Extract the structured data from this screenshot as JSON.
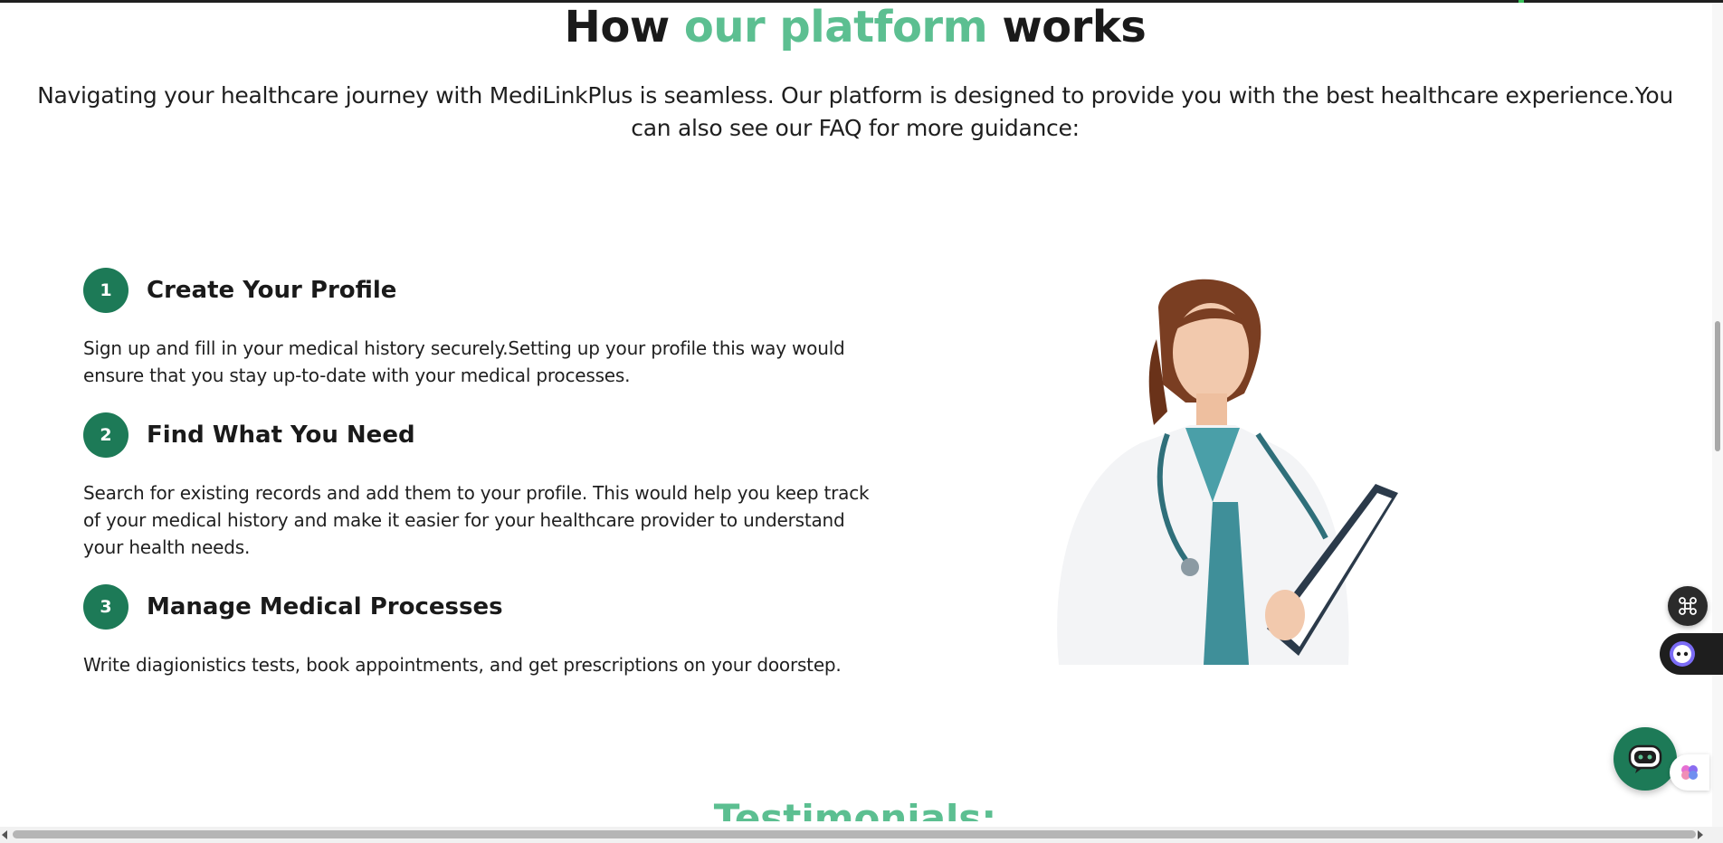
{
  "section": {
    "heading_part1": "How ",
    "heading_accent": "our platform",
    "heading_part2": " works",
    "intro": "Navigating your healthcare journey with MediLinkPlus is seamless. Our platform is designed to provide you with the best healthcare experience.You can also see our FAQ for more guidance:"
  },
  "steps": [
    {
      "number": "1",
      "title": "Create Your Profile",
      "description": "Sign up and fill in your medical history securely.Setting up your profile this way would ensure that you stay up-to-date with your medical processes."
    },
    {
      "number": "2",
      "title": "Find What You Need",
      "description": "Search for existing records and add them to your profile. This would help you keep track of your medical history and make it easier for your healthcare provider to understand your health needs."
    },
    {
      "number": "3",
      "title": "Manage Medical Processes",
      "description": "Write diagionistics tests, book appointments, and get prescriptions on your doorstep."
    }
  ],
  "testimonials": {
    "title": "Testimonials:"
  },
  "icons": {
    "shortcut": "command-icon",
    "assistant": "robot-icon",
    "chat": "chatbot-icon",
    "brain": "brain-icon",
    "illustration": "doctor-illustration"
  },
  "colors": {
    "accent": "#5cbf91",
    "brand_green": "#1d7a57",
    "text": "#1a1a1a"
  }
}
